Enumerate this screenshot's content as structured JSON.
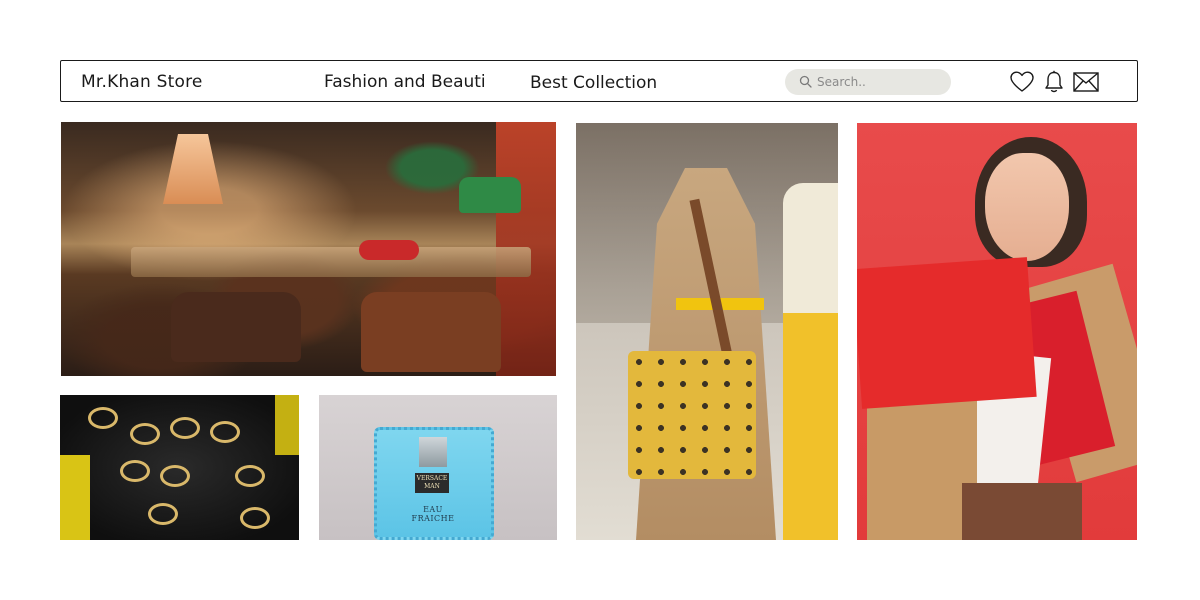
{
  "header": {
    "brand": "Mr.Khan Store",
    "nav": [
      "Fashion and Beauti",
      "Best Collection"
    ],
    "search_placeholder": "Search..",
    "icons": {
      "wishlist": "heart-icon",
      "notifications": "bell-icon",
      "messages": "mail-icon",
      "search": "search-icon"
    }
  },
  "gallery": {
    "perfume": {
      "brand": "VERSACE MAN",
      "name": "EAU FRAICHE"
    }
  },
  "colors": {
    "border": "#1a1a1a",
    "search_bg": "#e7e7e2",
    "accent_red": "#e23b3b"
  }
}
